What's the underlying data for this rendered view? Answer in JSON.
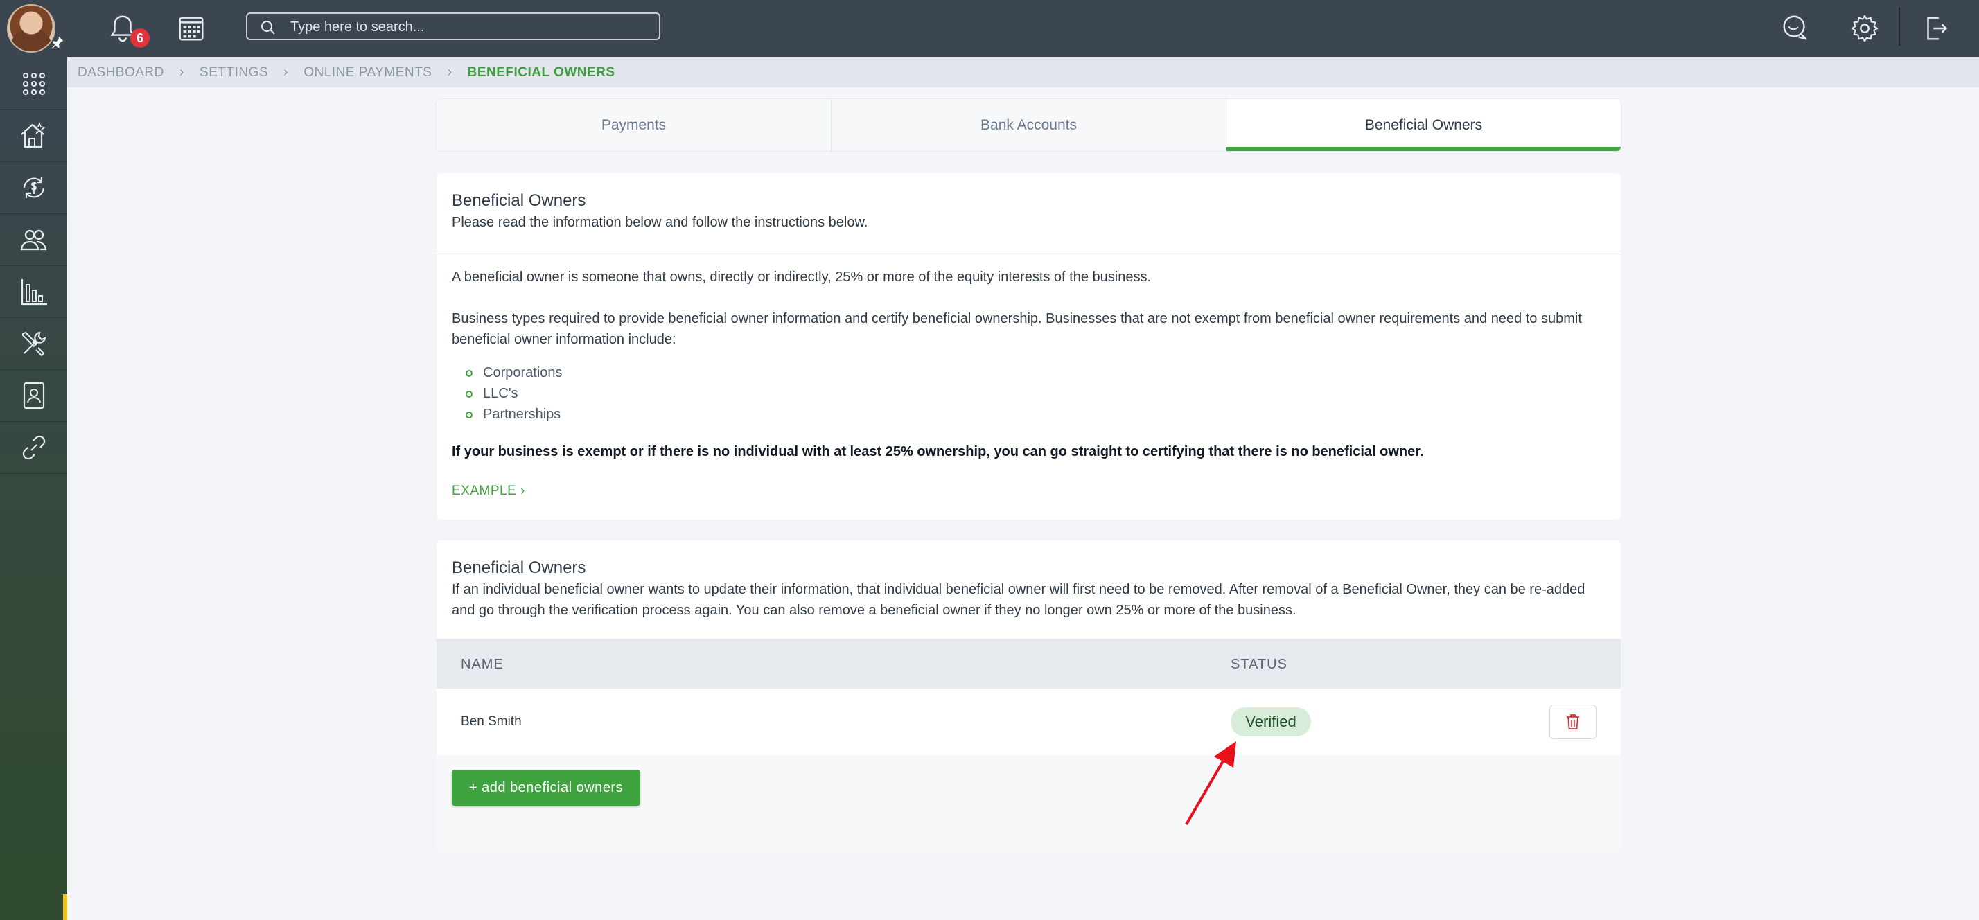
{
  "header": {
    "notification_count": "6",
    "search_placeholder": "Type here to search..."
  },
  "sidebar": {
    "items": [
      {
        "icon": "apps-grid-icon"
      },
      {
        "icon": "property-icon"
      },
      {
        "icon": "payments-cycle-icon"
      },
      {
        "icon": "people-icon"
      },
      {
        "icon": "reports-chart-icon"
      },
      {
        "icon": "tools-icon"
      },
      {
        "icon": "contacts-icon"
      },
      {
        "icon": "link-icon"
      }
    ]
  },
  "breadcrumb": [
    "DASHBOARD",
    "SETTINGS",
    "ONLINE PAYMENTS",
    "BENEFICIAL OWNERS"
  ],
  "tabs": [
    "Payments",
    "Bank Accounts",
    "Beneficial Owners"
  ],
  "info_card": {
    "title": "Beneficial Owners",
    "subtitle": "Please read the information below and follow the instructions below.",
    "para1": "A beneficial owner is someone that owns, directly or indirectly, 25% or more of the equity interests of the business.",
    "para2": "Business types required to provide beneficial owner information and certify beneficial ownership. Businesses that are not exempt from beneficial owner requirements and need to submit beneficial owner information include:",
    "business_types": [
      "Corporations",
      "LLC's",
      "Partnerships"
    ],
    "bold_note": "If your business is exempt or if there is no individual with at least 25% ownership, you can go straight to certifying that there is no beneficial owner.",
    "example_link": "EXAMPLE"
  },
  "owners_card": {
    "title": "Beneficial Owners",
    "description": "If an individual beneficial owner wants to update their information, that individual beneficial owner will first need to be removed. After removal of a Beneficial Owner, they can be re-added and go through the verification process again. You can also remove a beneficial owner if they no longer own 25% or more of the business.",
    "columns": [
      "NAME",
      "STATUS"
    ],
    "rows": [
      {
        "name": "Ben Smith",
        "status": "Verified"
      }
    ],
    "add_button": "+ add beneficial owners"
  },
  "colors": {
    "accent_green": "#3fa33f",
    "topbar": "#3b4651",
    "status_verified_bg": "#d7ecd9",
    "delete_red": "#e2323c",
    "annotation_arrow": "#e8101a"
  }
}
